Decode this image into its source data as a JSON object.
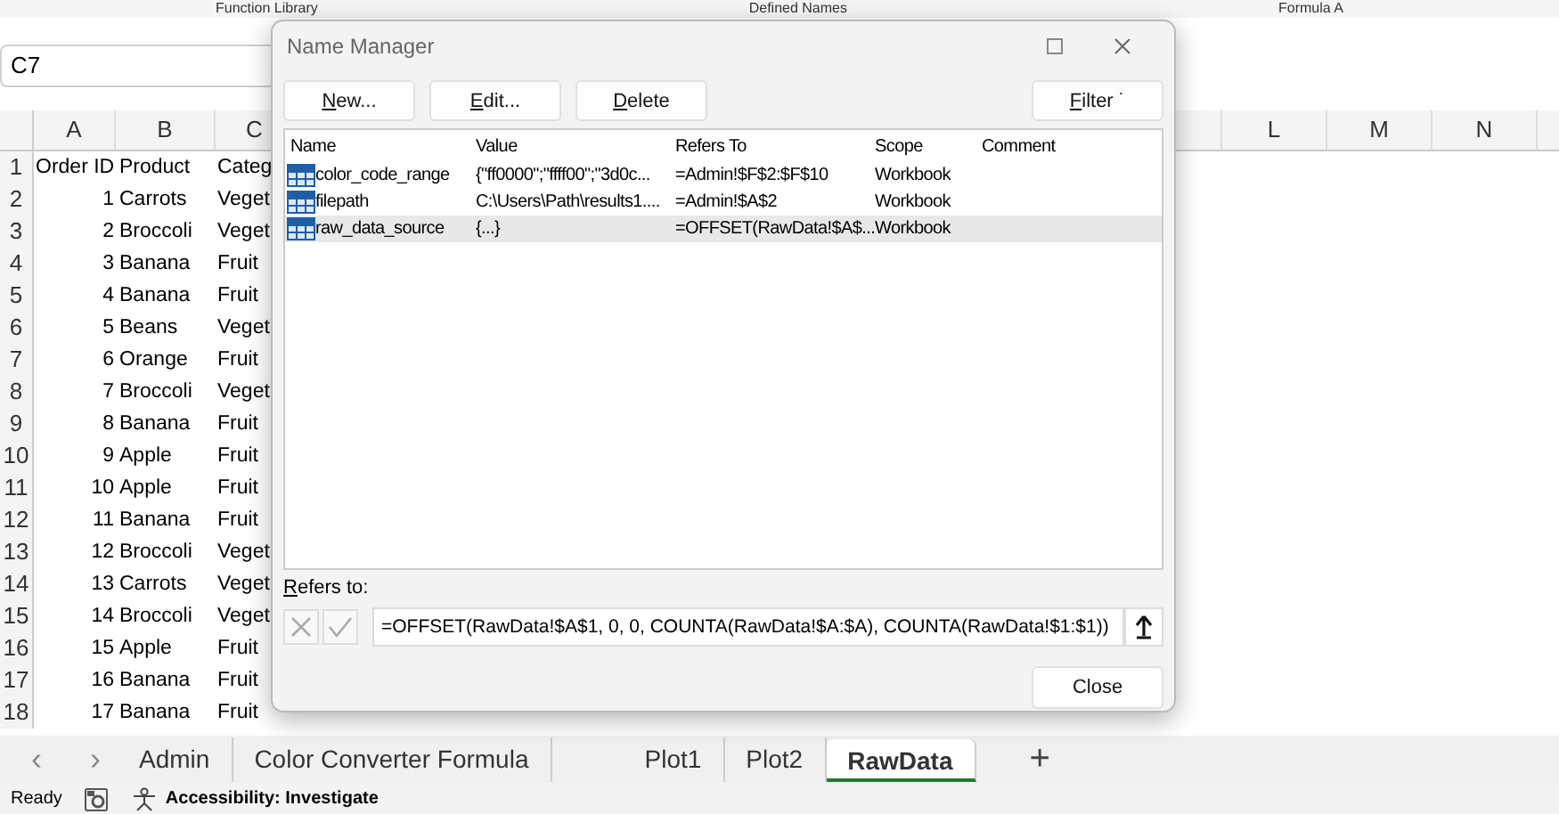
{
  "ribbon_groups": [
    "Function Library",
    "Defined Names",
    "Formula A"
  ],
  "name_box": {
    "value": "C7"
  },
  "sheet": {
    "columns": [
      "A",
      "B",
      "C",
      "L",
      "M",
      "N"
    ],
    "rows": [
      {
        "number": "1",
        "cells": [
          "Order ID",
          "Product",
          "Categ"
        ]
      },
      {
        "number": "2",
        "cells": [
          "1",
          "Carrots",
          "Veget"
        ]
      },
      {
        "number": "3",
        "cells": [
          "2",
          "Broccoli",
          "Veget"
        ]
      },
      {
        "number": "4",
        "cells": [
          "3",
          "Banana",
          "Fruit"
        ]
      },
      {
        "number": "5",
        "cells": [
          "4",
          "Banana",
          "Fruit"
        ]
      },
      {
        "number": "6",
        "cells": [
          "5",
          "Beans",
          "Veget"
        ]
      },
      {
        "number": "7",
        "cells": [
          "6",
          "Orange",
          "Fruit"
        ]
      },
      {
        "number": "8",
        "cells": [
          "7",
          "Broccoli",
          "Veget"
        ]
      },
      {
        "number": "9",
        "cells": [
          "8",
          "Banana",
          "Fruit"
        ]
      },
      {
        "number": "10",
        "cells": [
          "9",
          "Apple",
          "Fruit"
        ]
      },
      {
        "number": "11",
        "cells": [
          "10",
          "Apple",
          "Fruit"
        ]
      },
      {
        "number": "12",
        "cells": [
          "11",
          "Banana",
          "Fruit"
        ]
      },
      {
        "number": "13",
        "cells": [
          "12",
          "Broccoli",
          "Veget"
        ]
      },
      {
        "number": "14",
        "cells": [
          "13",
          "Carrots",
          "Veget"
        ]
      },
      {
        "number": "15",
        "cells": [
          "14",
          "Broccoli",
          "Veget"
        ]
      },
      {
        "number": "16",
        "cells": [
          "15",
          "Apple",
          "Fruit"
        ]
      },
      {
        "number": "17",
        "cells": [
          "16",
          "Banana",
          "Fruit"
        ]
      },
      {
        "number": "18",
        "cells": [
          "17",
          "Banana",
          "Fruit"
        ]
      }
    ]
  },
  "dialog": {
    "title": "Name Manager",
    "buttons": [
      {
        "label": "New..."
      },
      {
        "label": "Edit..."
      },
      {
        "label": "Delete"
      }
    ],
    "filter": {
      "label": "Filter",
      "caret": "˙"
    },
    "list": {
      "columns": [
        "Name",
        "Value",
        "Refers To",
        "Scope",
        "Comment"
      ],
      "rows": [
        {
          "name": "color_code_range",
          "value": "{\"ff0000\";\"ffff00\";\"3d0c...",
          "refers_to": "=Admin!$F$2:$F$10",
          "scope": "Workbook",
          "selected": false
        },
        {
          "name": "filepath",
          "value": "C:\\Users\\Path\\results1....",
          "refers_to": "=Admin!$A$2",
          "scope": "Workbook",
          "selected": false
        },
        {
          "name": "raw_data_source",
          "value": "{...}",
          "refers_to": "=OFFSET(RawData!$A$...",
          "scope": "Workbook",
          "selected": true
        }
      ]
    },
    "refers_label": {
      "label": "Refers to:"
    },
    "refers_value": "=OFFSET(RawData!$A$1, 0, 0, COUNTA(RawData!$A:$A), COUNTA(RawData!$1:$1))",
    "close_button": "Close"
  },
  "sheet_tabs": [
    {
      "label": "Admin",
      "selected": false
    },
    {
      "label": "Color Converter Formula",
      "selected": false
    },
    {
      "label": "Plot1",
      "selected": false
    },
    {
      "label": "Plot2",
      "selected": false
    },
    {
      "label": "RawData",
      "selected": true
    }
  ],
  "sheet_nav": [
    "‹",
    "›"
  ],
  "add_sheet": "+",
  "status_bar": {
    "mode": "Ready",
    "accessibility": "Accessibility: Investigate"
  }
}
